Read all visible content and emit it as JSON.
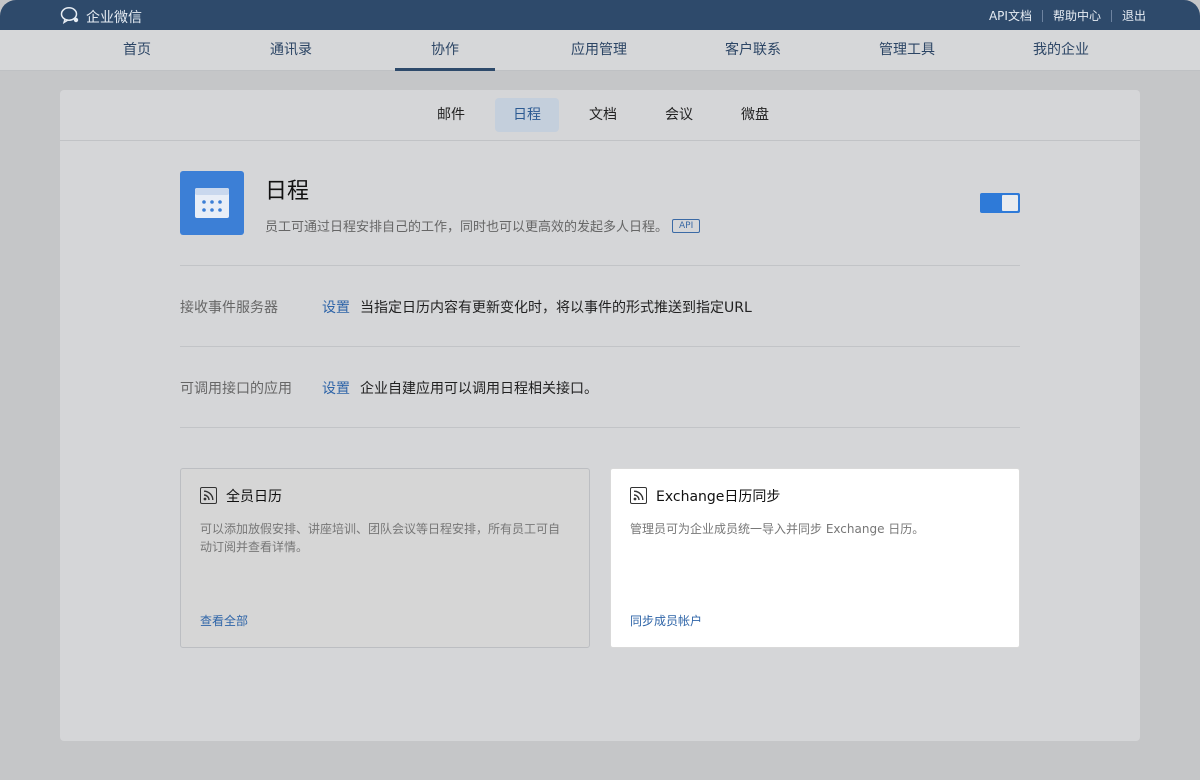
{
  "topbar": {
    "brand": "企业微信",
    "links": [
      "API文档",
      "帮助中心",
      "退出"
    ]
  },
  "main_nav": {
    "items": [
      "首页",
      "通讯录",
      "协作",
      "应用管理",
      "客户联系",
      "管理工具",
      "我的企业"
    ],
    "active": "协作"
  },
  "sub_nav": {
    "items": [
      "邮件",
      "日程",
      "文档",
      "会议",
      "微盘"
    ],
    "active": "日程"
  },
  "app": {
    "title": "日程",
    "description": "员工可通过日程安排自己的工作，同时也可以更高效的发起多人日程。",
    "api_badge": "API",
    "enabled": true
  },
  "settings": [
    {
      "label": "接收事件服务器",
      "link": "设置",
      "text": "当指定日历内容有更新变化时，将以事件的形式推送到指定URL"
    },
    {
      "label": "可调用接口的应用",
      "link": "设置",
      "text": "企业自建应用可以调用日程相关接口。"
    }
  ],
  "cards": [
    {
      "title": "全员日历",
      "description": "可以添加放假安排、讲座培训、团队会议等日程安排，所有员工可自动订阅并查看详情。",
      "link": "查看全部",
      "icon": "rss-icon"
    },
    {
      "title": "Exchange日历同步",
      "description": "管理员可为企业成员统一导入并同步 Exchange 日历。",
      "link": "同步成员帐户",
      "icon": "rss-icon"
    }
  ],
  "colors": {
    "topbar": "#2e4a6b",
    "accent": "#2e7ad8",
    "link": "#2f65a8"
  }
}
